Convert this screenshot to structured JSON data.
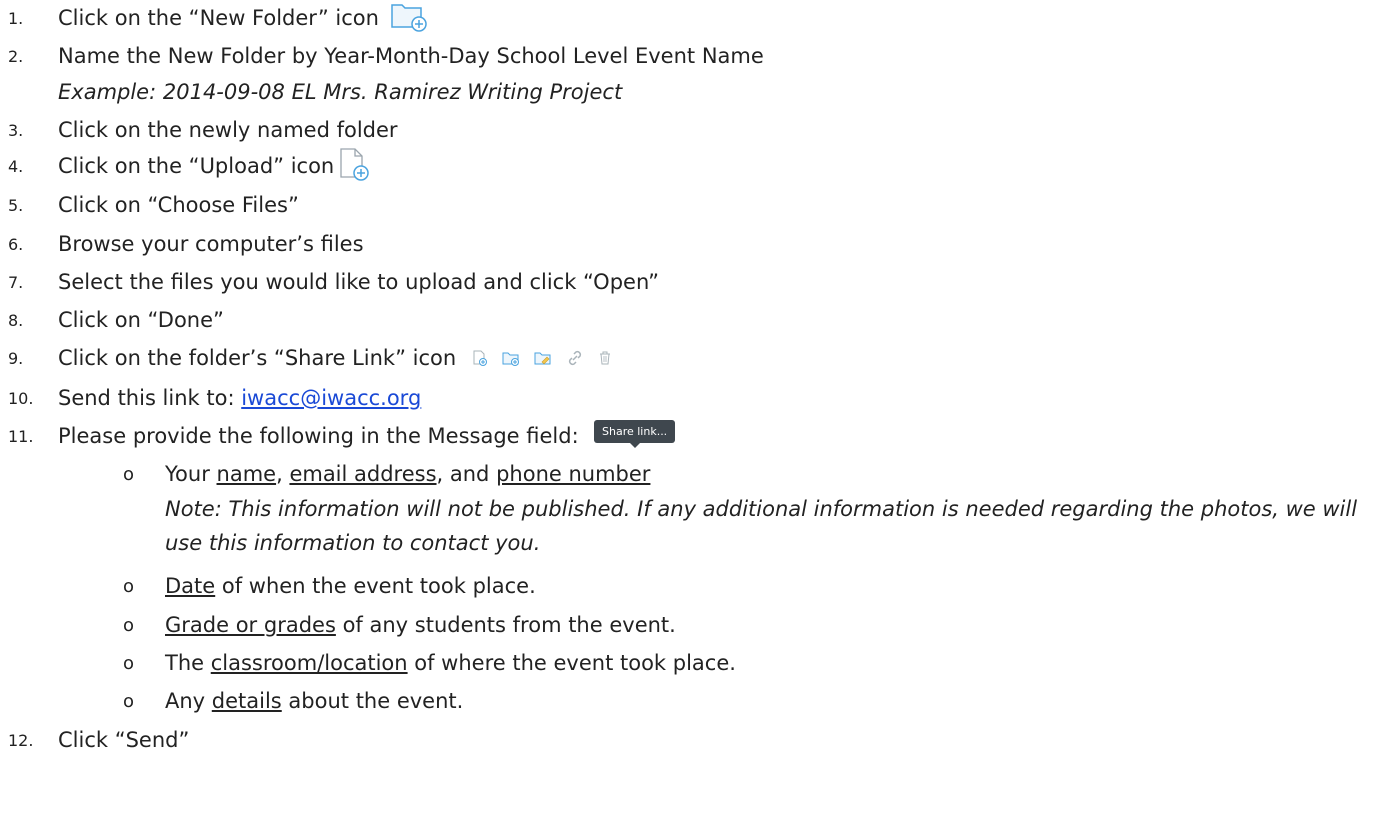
{
  "steps": {
    "s1": {
      "num": "1.",
      "text": "Click on the “New Folder” icon"
    },
    "s2": {
      "num": "2.",
      "text": "Name the New Folder by Year-Month-Day School Level Event Name"
    },
    "s2_example": "Example: 2014-09-08 EL Mrs. Ramirez Writing Project",
    "s3": {
      "num": "3.",
      "text": "Click on the newly named folder"
    },
    "s4": {
      "num": "4.",
      "text": "Click on the “Upload” icon"
    },
    "s5": {
      "num": "5.",
      "text": "Click on “Choose Files”"
    },
    "s6": {
      "num": "6.",
      "text": "Browse your computer’s files"
    },
    "s7": {
      "num": "7.",
      "text": "Select the files you would like to upload and click “Open”"
    },
    "s8": {
      "num": "8.",
      "text": "Click on “Done”"
    },
    "s9": {
      "num": "9.",
      "text": "Click on the folder’s “Share Link” icon"
    },
    "s10": {
      "num": "10.",
      "prefix": "Send this link to: ",
      "email": "iwacc@iwacc.org"
    },
    "s11": {
      "num": "11.",
      "text": "Please provide the following in the Message field:"
    },
    "s12": {
      "num": "12.",
      "text": "Click “Send”"
    }
  },
  "sub_items": {
    "b1": {
      "bullet": "o",
      "pre": "Your ",
      "name": "name",
      "sep1": ", ",
      "email": "email address",
      "sep2": ", and ",
      "phone": "phone number"
    },
    "note": "Note: This information will not be published. If any additional information is needed regarding the photos, we will use this information to contact you.",
    "b2": {
      "bullet": "o",
      "u": "Date",
      "rest": " of when the event took place."
    },
    "b3": {
      "bullet": "o",
      "u": "Grade or grades",
      "rest": " of any students from the event."
    },
    "b4": {
      "bullet": "o",
      "pre": "The ",
      "u": "classroom/location",
      "rest": " of where the event took place."
    },
    "b5": {
      "bullet": "o",
      "pre": "Any ",
      "u": "details",
      "rest": " about the event."
    }
  },
  "tooltip": "Share link...",
  "icons": [
    "new-folder-icon",
    "upload-file-icon",
    "file-add-icon",
    "folder-add-icon",
    "folder-edit-icon",
    "link-icon",
    "trash-icon"
  ],
  "colors": {
    "icon_blue": "#4aa3df",
    "link": "#1a49d6",
    "tooltip_bg": "#3f474e"
  }
}
